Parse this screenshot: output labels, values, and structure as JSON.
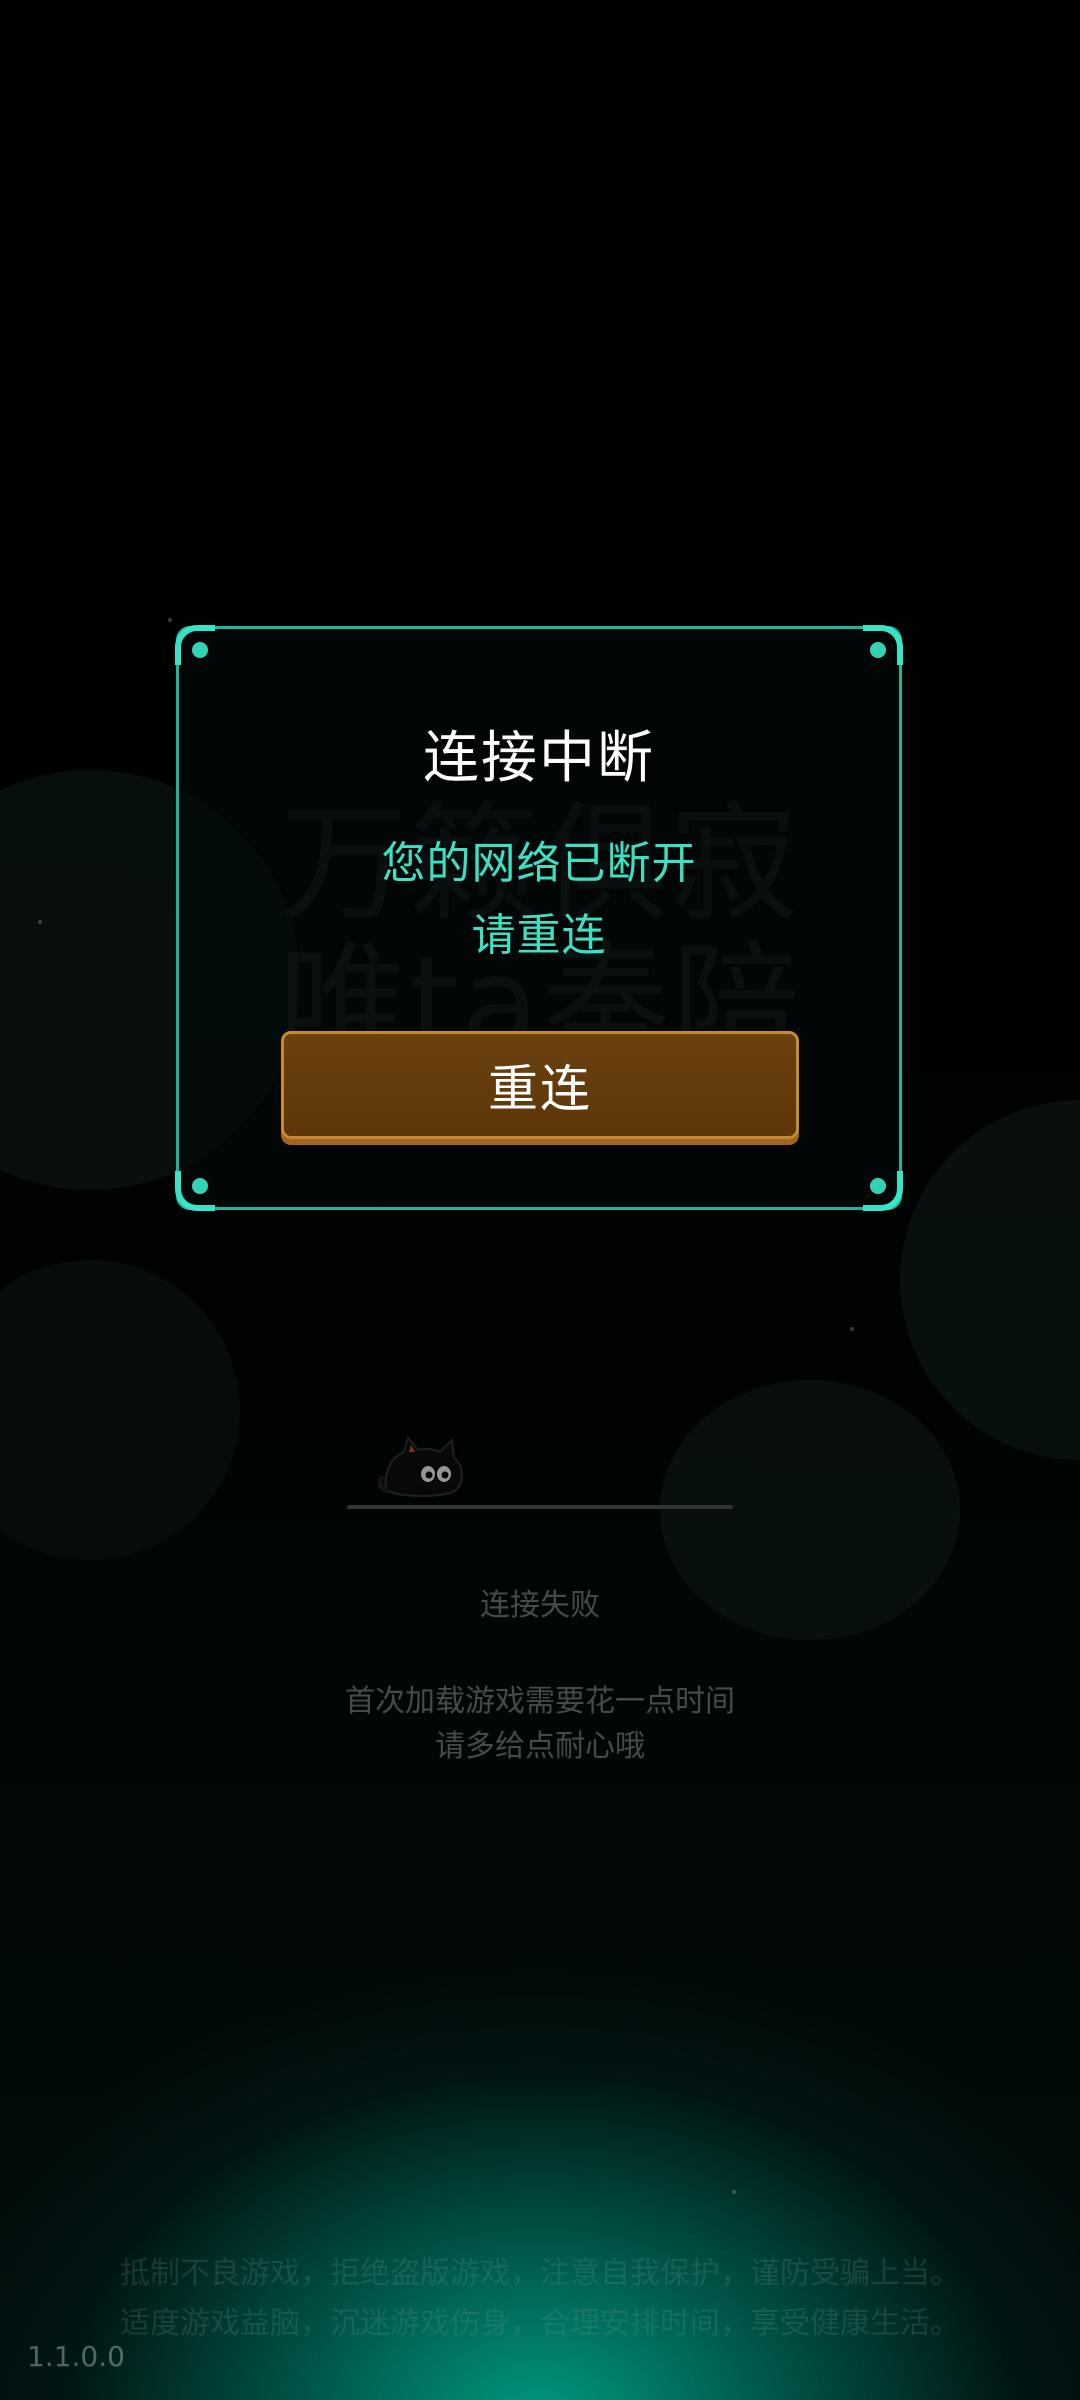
{
  "background": {
    "slogan_line1": "万籁俱寂",
    "slogan_line2": "唯ta奏陪"
  },
  "loading": {
    "status": "连接失败",
    "hint_line1": "首次加载游戏需要花一点时间",
    "hint_line2": "请多给点耐心哦"
  },
  "footer": {
    "notice_line1": "抵制不良游戏，拒绝盗版游戏，注意自我保护，谨防受骗上当。",
    "notice_line2": "适度游戏益脑，沉迷游戏伤身，合理安排时间，享受健康生活。",
    "version": "1.1.0.0"
  },
  "dialog": {
    "title": "连接中断",
    "message_line1": "您的网络已断开",
    "message_line2": "请重连",
    "reconnect_label": "重连"
  },
  "colors": {
    "accent": "#3ee0c2",
    "frame": "#1fb59b",
    "button_fill": "#5d3609",
    "button_border": "#c78a2f"
  }
}
